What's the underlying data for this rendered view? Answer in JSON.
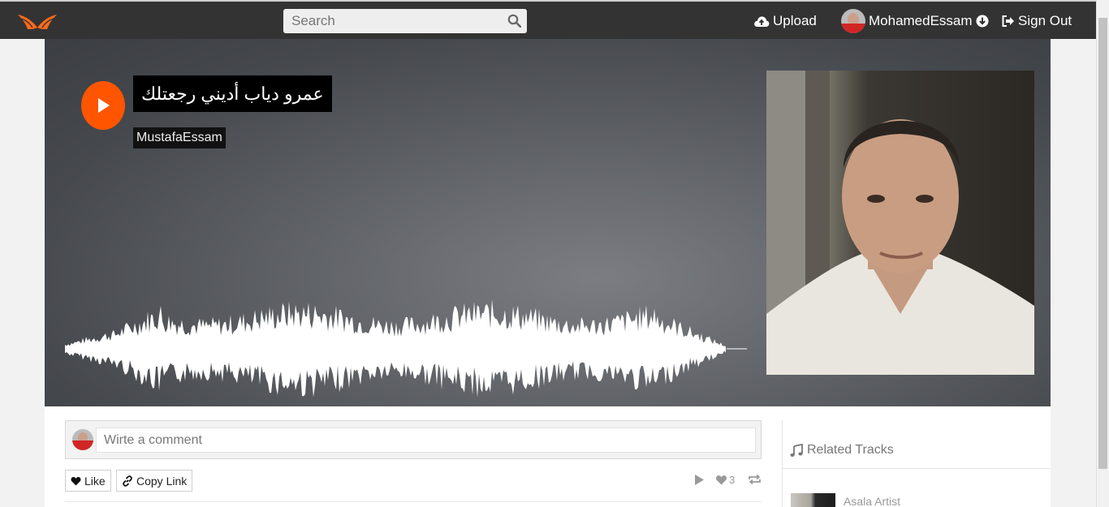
{
  "navbar": {
    "logo_icon": "wings-logo-icon",
    "search": {
      "placeholder": "Search",
      "value": "",
      "icon": "search-icon"
    },
    "upload": {
      "label": "Upload",
      "icon": "cloud-upload-icon"
    },
    "user": {
      "name": "MohamedEssam",
      "icon": "chevron-down-circle-icon"
    },
    "signout": {
      "label": "Sign Out",
      "icon": "sign-out-icon"
    }
  },
  "track": {
    "title": "عمرو دياب أديني رجعتلك",
    "artist": "MustafaEssam",
    "play_icon": "play-icon",
    "accent_color": "#ff5500"
  },
  "comment": {
    "placeholder": "Wirte a comment",
    "value": ""
  },
  "actions": {
    "like_label": "Like",
    "like_icon": "heart-icon",
    "copy_label": "Copy Link",
    "copy_icon": "link-icon",
    "likes_count": "3",
    "stat_icons": [
      "play-icon",
      "heart-icon",
      "repost-icon"
    ]
  },
  "related": {
    "heading": "Related Tracks",
    "heading_icon": "music-note-icon",
    "items": [
      {
        "name": "Asala Artist"
      }
    ]
  }
}
